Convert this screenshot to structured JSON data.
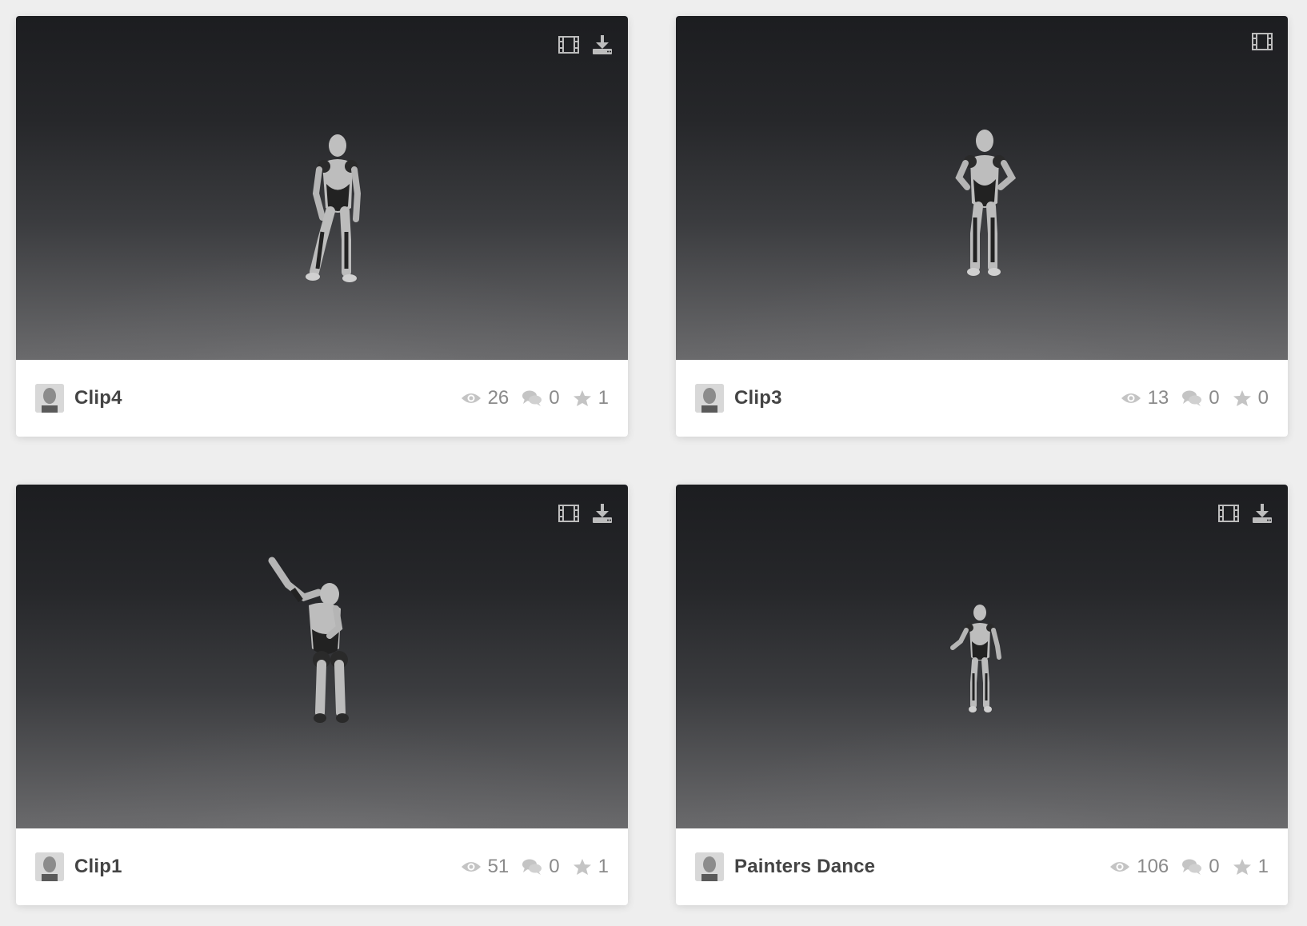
{
  "colors": {
    "page_bg": "#eeeeee",
    "card_bg": "#ffffff",
    "title_text": "#444444",
    "stat_text": "#8a8a8a",
    "icon_gray": "#bdbdbd"
  },
  "icons": {
    "thumb": [
      "film-icon",
      "download-icon"
    ],
    "stats": [
      "eye-icon",
      "comments-icon",
      "star-icon"
    ]
  },
  "cards": [
    {
      "title": "Clip4",
      "views": "26",
      "comments": "0",
      "likes": "1",
      "has_download": true
    },
    {
      "title": "Clip3",
      "views": "13",
      "comments": "0",
      "likes": "0",
      "has_download": false
    },
    {
      "title": "Clip1",
      "views": "51",
      "comments": "0",
      "likes": "1",
      "has_download": true
    },
    {
      "title": "Painters Dance",
      "views": "106",
      "comments": "0",
      "likes": "1",
      "has_download": true
    }
  ]
}
